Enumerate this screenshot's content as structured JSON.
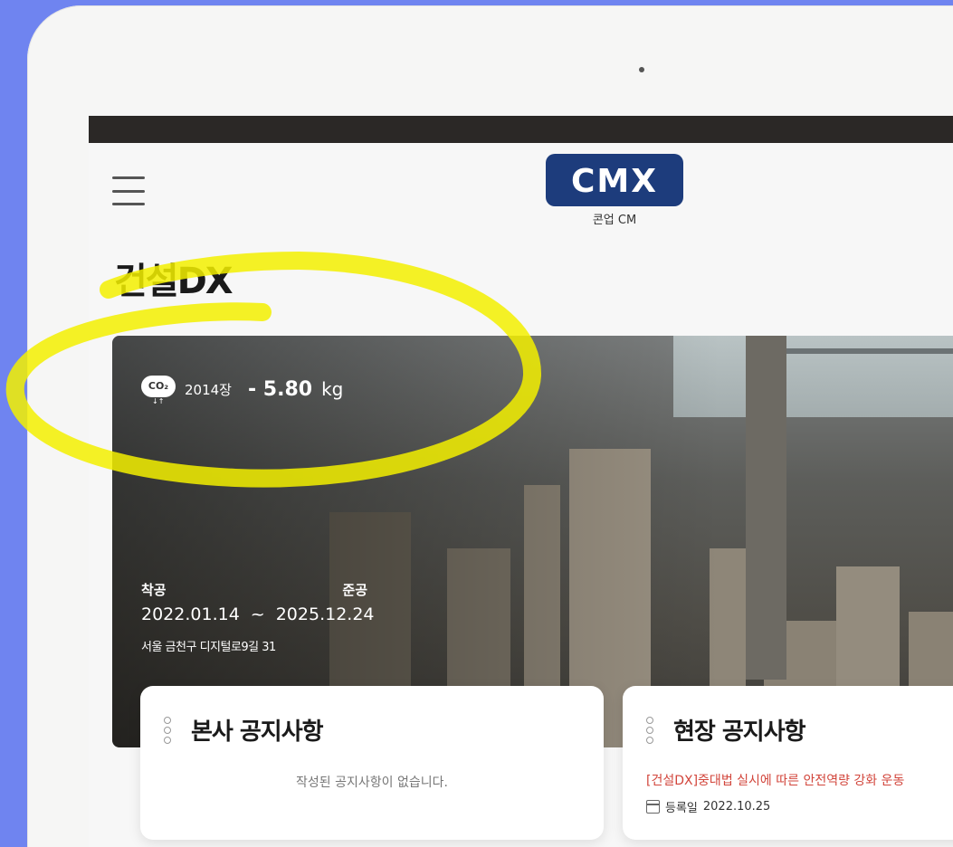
{
  "header": {
    "logo_text": "CMX",
    "logo_subtitle": "콘업 CM"
  },
  "section": {
    "title": "건설DX"
  },
  "hero": {
    "co2_label": "CO₂",
    "site_count": "2014장",
    "co2_value": "- 5.80",
    "co2_unit": "kg",
    "start_label": "착공",
    "end_label": "준공",
    "start_date": "2022.01.14",
    "date_separator": "~",
    "end_date": "2025.12.24",
    "address": "서울 금천구 디지털로9길 31"
  },
  "cards": {
    "hq": {
      "title": "본사 공지사항",
      "empty_text": "작성된 공지사항이 없습니다."
    },
    "site": {
      "title": "현장 공지사항",
      "notice": "[건설DX]중대법 실시에 따른 안전역량 강화 운동",
      "reg_label": "등록일",
      "reg_date": "2022.10.25"
    }
  },
  "colors": {
    "background": "#6f84f0",
    "logo_bg": "#1d3c7c",
    "notice_red": "#d2453b",
    "highlight": "#f3f000"
  }
}
